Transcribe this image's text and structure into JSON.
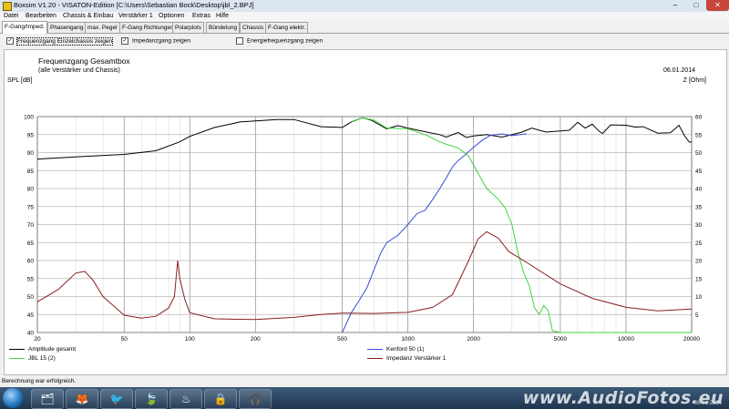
{
  "window": {
    "title": "Boxsim V1.20 - VISATON-Edition [C:\\Users\\Sebastian Bock\\Desktop\\jbl_2.BPJ]",
    "controls": [
      "–",
      "□",
      "✕"
    ]
  },
  "menu": [
    "Datei",
    "Bearbeiten",
    "Chassis & Einbau",
    "Verstärker 1",
    "Optionen",
    "Extras",
    "Hilfe"
  ],
  "tabs": [
    {
      "label": "F-Gang/Imped.",
      "active": true
    },
    {
      "label": "Phasengang"
    },
    {
      "label": "max. Pegel"
    },
    {
      "label": "F-Gang Richtungen"
    },
    {
      "label": "Polarplots"
    },
    {
      "label": "Bündelung"
    },
    {
      "label": "Chassis"
    },
    {
      "label": "F-Gang elektr."
    }
  ],
  "checkboxes": [
    {
      "label": "Frequenzgang Einzelchassis zeigen",
      "checked": true
    },
    {
      "label": "Impedanzgang zeigen",
      "checked": true
    },
    {
      "label": "Energiefrequenzgang zeigen",
      "checked": false
    }
  ],
  "chart": {
    "title": "Frequenzgang Gesamtbox",
    "subtitle": "(alle Verstärker und Chassis)",
    "date": "06.01.2014",
    "ylabel_left": "SPL [dB]",
    "ylabel_right": "Z [Ohm]"
  },
  "chart_data": {
    "type": "line",
    "x_scale": "log",
    "xlim": [
      20,
      20000
    ],
    "ylim": [
      40,
      100
    ],
    "y2lim": [
      0,
      60
    ],
    "x_ticks": [
      20,
      50,
      100,
      200,
      500,
      1000,
      2000,
      5000,
      10000,
      20000
    ],
    "y_ticks": [
      40,
      45,
      50,
      55,
      60,
      65,
      70,
      75,
      80,
      85,
      90,
      95,
      100
    ],
    "y2_ticks": [
      5,
      10,
      15,
      20,
      25,
      30,
      35,
      40,
      45,
      50,
      55,
      60
    ],
    "series": [
      {
        "name": "Amplitude gesamt",
        "color": "#000000",
        "axis": "left",
        "points": [
          [
            20,
            88.2
          ],
          [
            30,
            88.8
          ],
          [
            50,
            89.5
          ],
          [
            70,
            90.5
          ],
          [
            90,
            93
          ],
          [
            100,
            94.5
          ],
          [
            130,
            97
          ],
          [
            170,
            98.5
          ],
          [
            250,
            99.2
          ],
          [
            300,
            99.2
          ],
          [
            400,
            97.2
          ],
          [
            500,
            97
          ],
          [
            550,
            98.5
          ],
          [
            620,
            99.7
          ],
          [
            680,
            99
          ],
          [
            800,
            96.6
          ],
          [
            900,
            97.5
          ],
          [
            1000,
            96.8
          ],
          [
            1200,
            95.8
          ],
          [
            1400,
            95
          ],
          [
            1500,
            94.3
          ],
          [
            1700,
            95.6
          ],
          [
            1850,
            94.2
          ],
          [
            2000,
            94.6
          ],
          [
            2300,
            95
          ],
          [
            2700,
            94.3
          ],
          [
            3300,
            95.6
          ],
          [
            3700,
            96.8
          ],
          [
            4300,
            95.7
          ],
          [
            5000,
            96
          ],
          [
            5500,
            96.2
          ],
          [
            6000,
            98.4
          ],
          [
            6500,
            96.8
          ],
          [
            7000,
            97.9
          ],
          [
            7500,
            96
          ],
          [
            7800,
            95.3
          ],
          [
            8500,
            97.7
          ],
          [
            10000,
            97.6
          ],
          [
            11000,
            97.1
          ],
          [
            12000,
            97.2
          ],
          [
            14000,
            95.4
          ],
          [
            16000,
            95.5
          ],
          [
            17500,
            97.6
          ],
          [
            18500,
            94.8
          ],
          [
            19500,
            92.9
          ],
          [
            20000,
            93
          ]
        ]
      },
      {
        "name": "Kenford 50 (1)",
        "color": "#3a4bd8",
        "axis": "left",
        "points": [
          [
            500,
            40
          ],
          [
            550,
            45.5
          ],
          [
            600,
            49
          ],
          [
            650,
            52.5
          ],
          [
            700,
            57.5
          ],
          [
            750,
            62
          ],
          [
            800,
            65
          ],
          [
            900,
            67
          ],
          [
            1000,
            70
          ],
          [
            1100,
            73
          ],
          [
            1200,
            74
          ],
          [
            1300,
            77
          ],
          [
            1400,
            80
          ],
          [
            1500,
            83
          ],
          [
            1600,
            86
          ],
          [
            1700,
            87.8
          ],
          [
            1800,
            89
          ],
          [
            2000,
            91.5
          ],
          [
            2200,
            93.5
          ],
          [
            2400,
            94.8
          ],
          [
            2700,
            95.2
          ],
          [
            3000,
            94.7
          ],
          [
            3500,
            95.2
          ]
        ]
      },
      {
        "name": "JBL 15 (2)",
        "color": "#3fd43f",
        "axis": "left",
        "points": [
          [
            550,
            98.6
          ],
          [
            620,
            99.7
          ],
          [
            700,
            99
          ],
          [
            800,
            96.8
          ],
          [
            1000,
            96.6
          ],
          [
            1200,
            95
          ],
          [
            1400,
            93
          ],
          [
            1500,
            92.3
          ],
          [
            1700,
            91.3
          ],
          [
            1900,
            89
          ],
          [
            2100,
            84.2
          ],
          [
            2300,
            80
          ],
          [
            2600,
            77
          ],
          [
            2800,
            74.5
          ],
          [
            3000,
            70
          ],
          [
            3200,
            62
          ],
          [
            3400,
            56.5
          ],
          [
            3600,
            53
          ],
          [
            3800,
            47
          ],
          [
            4000,
            45
          ],
          [
            4200,
            47.5
          ],
          [
            4400,
            46
          ],
          [
            4600,
            40.5
          ],
          [
            5000,
            40
          ],
          [
            20000,
            40
          ]
        ]
      },
      {
        "name": "Impedanz Verstärker 1",
        "color": "#8a1e1e",
        "axis": "right",
        "points": [
          [
            20,
            8.5
          ],
          [
            25,
            12
          ],
          [
            30,
            16.5
          ],
          [
            33,
            17
          ],
          [
            36,
            14.5
          ],
          [
            40,
            10
          ],
          [
            50,
            4.8
          ],
          [
            60,
            4
          ],
          [
            70,
            4.5
          ],
          [
            80,
            6.8
          ],
          [
            85,
            10
          ],
          [
            88,
            20
          ],
          [
            90,
            15
          ],
          [
            95,
            9
          ],
          [
            100,
            5.5
          ],
          [
            130,
            3.8
          ],
          [
            200,
            3.6
          ],
          [
            300,
            4.2
          ],
          [
            400,
            5
          ],
          [
            500,
            5.4
          ],
          [
            700,
            5.3
          ],
          [
            1000,
            5.6
          ],
          [
            1300,
            7
          ],
          [
            1600,
            10.5
          ],
          [
            1900,
            20
          ],
          [
            2100,
            26
          ],
          [
            2300,
            28
          ],
          [
            2600,
            26.2
          ],
          [
            2900,
            22.5
          ],
          [
            3500,
            19.5
          ],
          [
            5000,
            13.5
          ],
          [
            7000,
            9.5
          ],
          [
            10000,
            7
          ],
          [
            14000,
            6
          ],
          [
            20000,
            6.5
          ]
        ]
      }
    ]
  },
  "status": {
    "text": "Berechnung war erfolgreich."
  },
  "taskbar": {
    "buttons": [
      "🗂",
      "🦊",
      "🐦",
      "🍃",
      "♨",
      "🔒",
      "🎧"
    ],
    "watermark": "www.AudioFotos.eu",
    "date": "06.01.2014"
  }
}
